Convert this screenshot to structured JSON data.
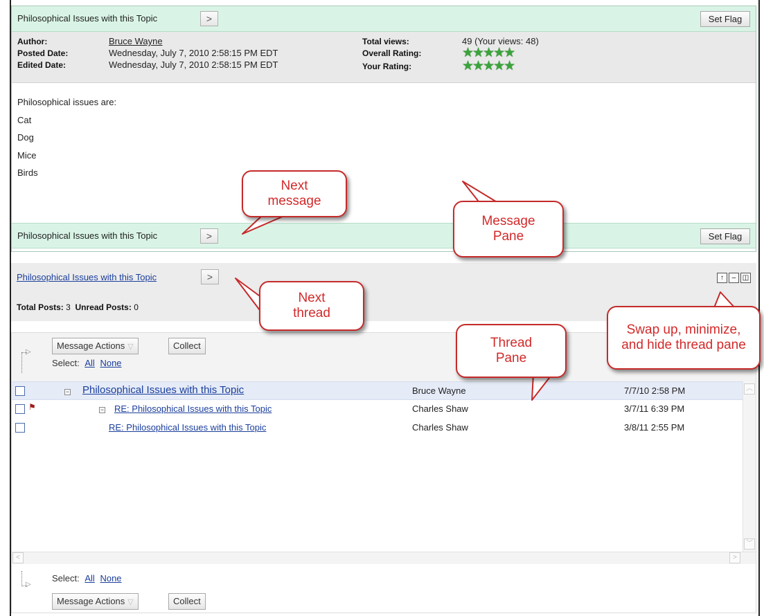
{
  "message": {
    "title": "Philosophical Issues with this Topic",
    "next_symbol": ">",
    "set_flag": "Set Flag",
    "author_label": "Author:",
    "author": "Bruce Wayne",
    "posted_label": "Posted Date:",
    "posted": "Wednesday, July 7, 2010 2:58:15 PM EDT",
    "edited_label": "Edited Date:",
    "edited": "Wednesday, July 7, 2010 2:58:15 PM EDT",
    "views_label": "Total views:",
    "views": "49 (Your views: 48)",
    "overall_label": "Overall Rating:",
    "overall_stars": "★★★★★",
    "overall_rating": 5,
    "your_label": "Your Rating:",
    "your_stars": "★★★★★",
    "your_rating": 5,
    "body": [
      "Philosophical issues are:",
      "Cat",
      "Dog",
      "Mice",
      "Birds"
    ]
  },
  "thread": {
    "title": "Philosophical Issues with this Topic",
    "next_symbol": ">",
    "total_posts_label": "Total Posts:",
    "total_posts": "3",
    "unread_posts_label": "Unread Posts:",
    "unread_posts": "0",
    "window_buttons": [
      "swap-up-icon",
      "minimize-icon",
      "hide-icon"
    ]
  },
  "toolbar": {
    "message_actions": "Message Actions",
    "collect": "Collect",
    "select_label": "Select:",
    "all": "All",
    "none": "None"
  },
  "posts": [
    {
      "title": "Philosophical Issues with this Topic",
      "author": "Bruce Wayne",
      "date": "7/7/10 2:58 PM",
      "flagged": false
    },
    {
      "title": "RE: Philosophical Issues with this Topic",
      "author": "Charles Shaw",
      "date": "3/7/11 6:39 PM",
      "flagged": true
    },
    {
      "title": "RE: Philosophical Issues with this Topic",
      "author": "Charles Shaw",
      "date": "3/8/11 2:55 PM",
      "flagged": false
    }
  ],
  "callouts": {
    "next_message": "Next message",
    "message_pane": "Message Pane",
    "next_thread": "Next thread",
    "thread_pane": "Thread Pane",
    "swap": "Swap up, minimize, and hide thread pane"
  },
  "colors": {
    "callout_border": "#c62a2a",
    "callout_text": "#d22a2a",
    "header_green": "#d9f4e6",
    "link_blue": "#1a3e9c",
    "star_green": "#3aa33a"
  }
}
